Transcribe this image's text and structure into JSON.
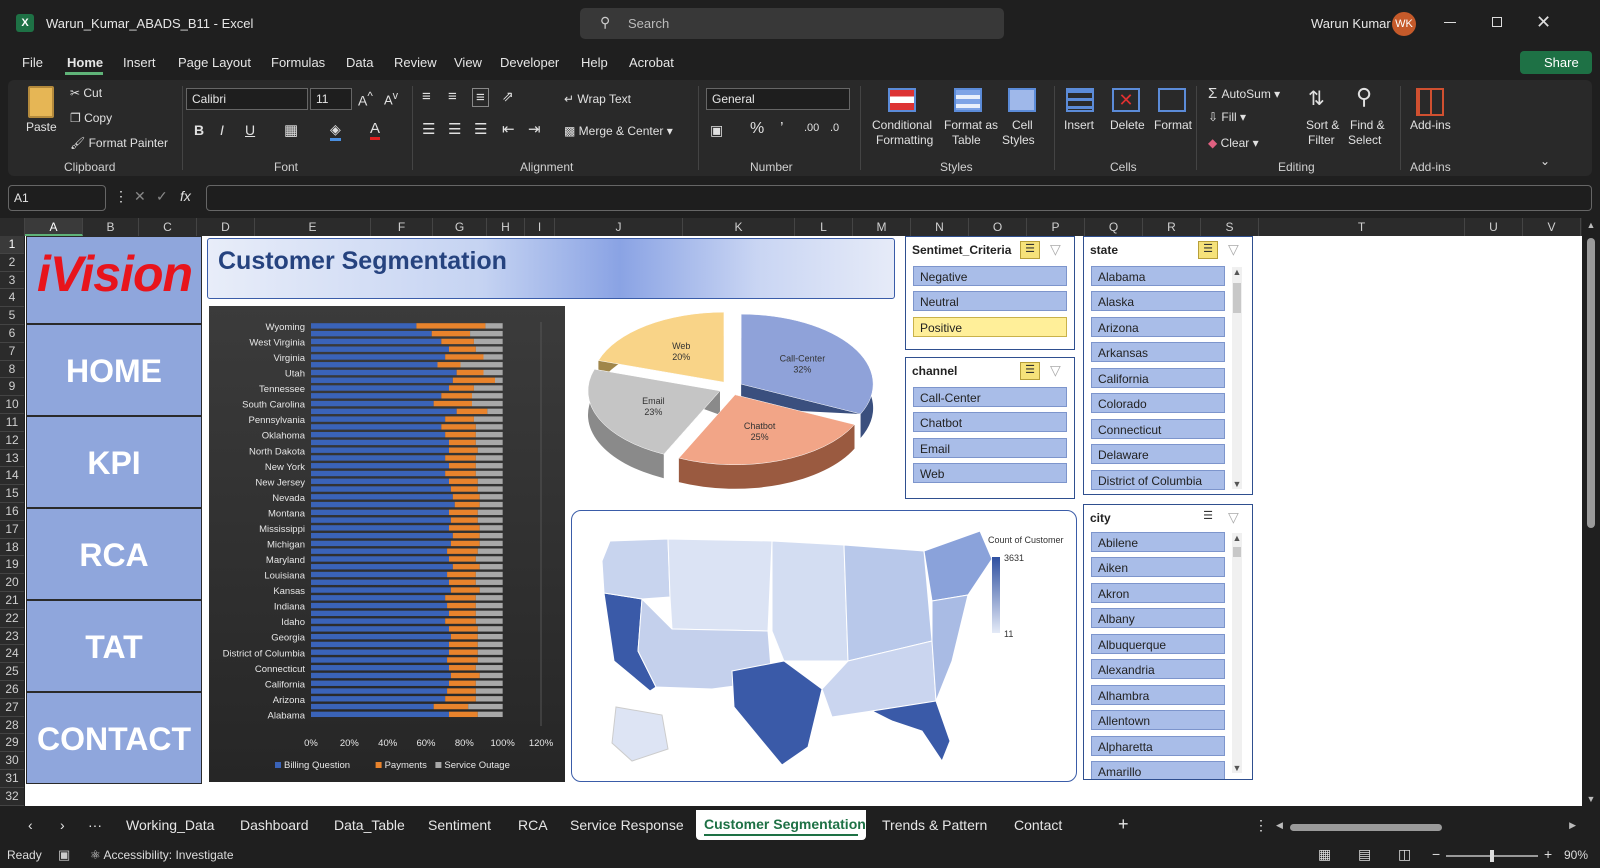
{
  "app": {
    "title": "Warun_Kumar_ABADS_B11 - Excel",
    "search_placeholder": "Search",
    "user_name": "Warun Kumar",
    "user_initials": "WK",
    "accent": "#1e7145"
  },
  "menu": [
    "File",
    "Home",
    "Insert",
    "Page Layout",
    "Formulas",
    "Data",
    "Review",
    "View",
    "Developer",
    "Help",
    "Acrobat"
  ],
  "share_label": "Share",
  "ribbon": {
    "clipboard": {
      "paste": "Paste",
      "cut": "Cut",
      "copy": "Copy",
      "format_painter": "Format Painter",
      "group": "Clipboard"
    },
    "font": {
      "name": "Calibri",
      "size": "11",
      "group": "Font"
    },
    "alignment": {
      "wrap": "Wrap Text",
      "merge": "Merge & Center",
      "group": "Alignment"
    },
    "number": {
      "format": "General",
      "group": "Number"
    },
    "styles": {
      "cond1": "Conditional",
      "cond2": "Formatting",
      "fmt1": "Format as",
      "fmt2": "Table",
      "cell1": "Cell",
      "cell2": "Styles",
      "group": "Styles"
    },
    "cells": {
      "insert": "Insert",
      "delete": "Delete",
      "format": "Format",
      "group": "Cells"
    },
    "editing": {
      "autosum": "AutoSum",
      "fill": "Fill",
      "clear": "Clear",
      "sort1": "Sort &",
      "sort2": "Filter",
      "find1": "Find &",
      "find2": "Select",
      "group": "Editing"
    },
    "addins": {
      "label": "Add-ins",
      "group": "Add-ins"
    }
  },
  "namebox": "A1",
  "columns": [
    "A",
    "B",
    "C",
    "D",
    "E",
    "F",
    "G",
    "H",
    "I",
    "J",
    "K",
    "L",
    "M",
    "N",
    "O",
    "P",
    "Q",
    "R",
    "S",
    "T",
    "U",
    "V"
  ],
  "rows": [
    "1",
    "2",
    "3",
    "4",
    "5",
    "6",
    "7",
    "8",
    "9",
    "10",
    "11",
    "12",
    "13",
    "14",
    "15",
    "16",
    "17",
    "18",
    "19",
    "20",
    "21",
    "22",
    "23",
    "24",
    "25",
    "26",
    "27",
    "28",
    "29",
    "30",
    "31",
    "32"
  ],
  "sheet": {
    "logo": "iVision",
    "banner": "Customer Segmentation",
    "nav": [
      "HOME",
      "KPI",
      "RCA",
      "TAT",
      "CONTACT"
    ]
  },
  "slicers": {
    "sentiment": {
      "title": "Sentimet_Criteria",
      "items": [
        "Negative",
        "Neutral",
        "Positive"
      ],
      "selected": "Positive"
    },
    "channel": {
      "title": "channel",
      "items": [
        "Call-Center",
        "Chatbot",
        "Email",
        "Web"
      ]
    },
    "state": {
      "title": "state",
      "items": [
        "Alabama",
        "Alaska",
        "Arizona",
        "Arkansas",
        "California",
        "Colorado",
        "Connecticut",
        "Delaware",
        "District of Columbia"
      ]
    },
    "city": {
      "title": "city",
      "items": [
        "Abilene",
        "Aiken",
        "Akron",
        "Albany",
        "Albuquerque",
        "Alexandria",
        "Alhambra",
        "Allentown",
        "Alpharetta",
        "Amarillo"
      ]
    }
  },
  "chart_data": [
    {
      "type": "bar",
      "stacked": true,
      "orientation": "horizontal",
      "categories": [
        "Wyoming",
        "",
        "West Virginia",
        "",
        "Virginia",
        "",
        "Utah",
        "",
        "Tennessee",
        "",
        "South Carolina",
        "",
        "Pennsylvania",
        "",
        "Oklahoma",
        "",
        "North Dakota",
        "",
        "New York",
        "",
        "New Jersey",
        "",
        "Nevada",
        "",
        "Montana",
        "",
        "Mississippi",
        "",
        "Michigan",
        "",
        "Maryland",
        "",
        "Louisiana",
        "",
        "Kansas",
        "",
        "Indiana",
        "",
        "Idaho",
        "",
        "Georgia",
        "",
        "District of Columbia",
        "",
        "Connecticut",
        "",
        "California",
        "",
        "Arizona",
        "",
        "Alabama",
        ""
      ],
      "series": [
        {
          "name": "Billing Question",
          "color": "#3a63b8",
          "values": [
            55,
            63,
            68,
            72,
            70,
            66,
            76,
            74,
            72,
            68,
            64,
            76,
            70,
            68,
            70,
            72,
            72,
            70,
            72,
            70,
            72,
            73,
            74,
            75,
            72,
            73,
            72,
            74,
            73,
            71,
            72,
            74,
            71,
            72,
            73,
            70,
            71,
            72,
            70,
            72,
            73,
            72,
            72,
            71,
            72,
            73,
            72,
            71,
            70,
            64,
            72
          ]
        },
        {
          "name": "Payments",
          "color": "#e8832c",
          "values": [
            36,
            20,
            17,
            14,
            20,
            12,
            14,
            22,
            13,
            16,
            20,
            16,
            15,
            18,
            16,
            14,
            15,
            16,
            14,
            16,
            15,
            14,
            14,
            13,
            15,
            14,
            16,
            14,
            15,
            16,
            14,
            14,
            15,
            14,
            15,
            16,
            15,
            14,
            16,
            15,
            14,
            15,
            15,
            16,
            14,
            15,
            14,
            15,
            16,
            18,
            15
          ]
        },
        {
          "name": "Service Outage",
          "color": "#a8a8a8",
          "values": [
            9,
            17,
            15,
            14,
            10,
            22,
            10,
            4,
            15,
            16,
            16,
            8,
            15,
            14,
            14,
            14,
            13,
            14,
            14,
            14,
            13,
            13,
            12,
            12,
            13,
            13,
            12,
            12,
            12,
            13,
            14,
            12,
            14,
            14,
            12,
            14,
            14,
            14,
            14,
            13,
            13,
            13,
            13,
            13,
            14,
            12,
            14,
            14,
            14,
            18,
            13
          ]
        }
      ],
      "xticks": [
        "0%",
        "20%",
        "40%",
        "60%",
        "80%",
        "100%",
        "120%"
      ],
      "xlim": [
        0,
        120
      ],
      "legend": "bottom"
    },
    {
      "type": "pie",
      "categories": [
        "Call-Center",
        "Chatbot",
        "Email",
        "Web"
      ],
      "values": [
        32,
        25,
        23,
        20
      ],
      "labels": [
        "32%",
        "25%",
        "23%",
        "20%"
      ],
      "colors": [
        "#8fa2d9",
        "#f2a587",
        "#c5c5c5",
        "#f9d488"
      ]
    },
    {
      "type": "map",
      "legend_title": "Count of Customer",
      "max": 3631,
      "min": 11,
      "max_label": "3631",
      "min_label": "11"
    }
  ],
  "tabs": [
    "Working_Data",
    "Dashboard",
    "Data_Table",
    "Sentiment",
    "RCA",
    "Service Response",
    "Customer Segmentation",
    "Trends & Pattern",
    "Contact"
  ],
  "active_tab": "Customer Segmentation",
  "status": {
    "ready": "Ready",
    "accessibility": "Accessibility: Investigate",
    "zoom": "90%"
  }
}
